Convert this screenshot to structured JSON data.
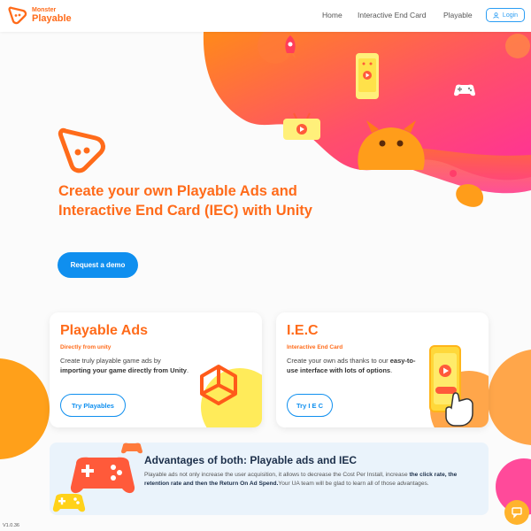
{
  "header": {
    "brand_top": "Monster",
    "brand_bottom": "Playable",
    "nav": [
      "Home",
      "Interactive End Card",
      "Playable"
    ],
    "login_label": "Login"
  },
  "hero": {
    "title": "Create your own Playable Ads and Interactive End Card (IEC) with Unity",
    "cta_label": "Request a demo"
  },
  "cards": [
    {
      "title": "Playable Ads",
      "subtitle": "Directly from unity",
      "desc_before": "Create truly playable game ads by ",
      "desc_bold": "importing your game directly from Unity",
      "desc_after": ".",
      "button_label": "Try Playables"
    },
    {
      "title": "I.E.C",
      "subtitle": "Interactive End Card",
      "desc_before": "Create your own ads thanks to our ",
      "desc_bold": "easy-to-use interface with lots of options",
      "desc_after": ".",
      "button_label": "Try I E C"
    }
  ],
  "advantages": {
    "title": "Advantages of both: Playable ads and IEC",
    "desc_1": "Playable ads not only increase the user acquisition, it allows to decrease the Cost Per Install, increase ",
    "desc_2": "the click rate, the retention rate and then the Return On Ad Spend.",
    "desc_3": "Your UA team will be glad to learn all of those advantages."
  },
  "version": "V1.0.36",
  "colors": {
    "brand_orange": "#ff6b1a",
    "primary_blue": "#0f8fef",
    "hero_pink": "#ff3d8b",
    "advantages_bg": "#eaf3fb"
  },
  "icons": [
    "monster-logo-icon",
    "user-icon",
    "rocket-icon",
    "phone-icon",
    "gamepad-icon",
    "tv-monster-icon",
    "monster-icon",
    "unity-icon",
    "hand-pointer-icon",
    "chat-icon"
  ]
}
